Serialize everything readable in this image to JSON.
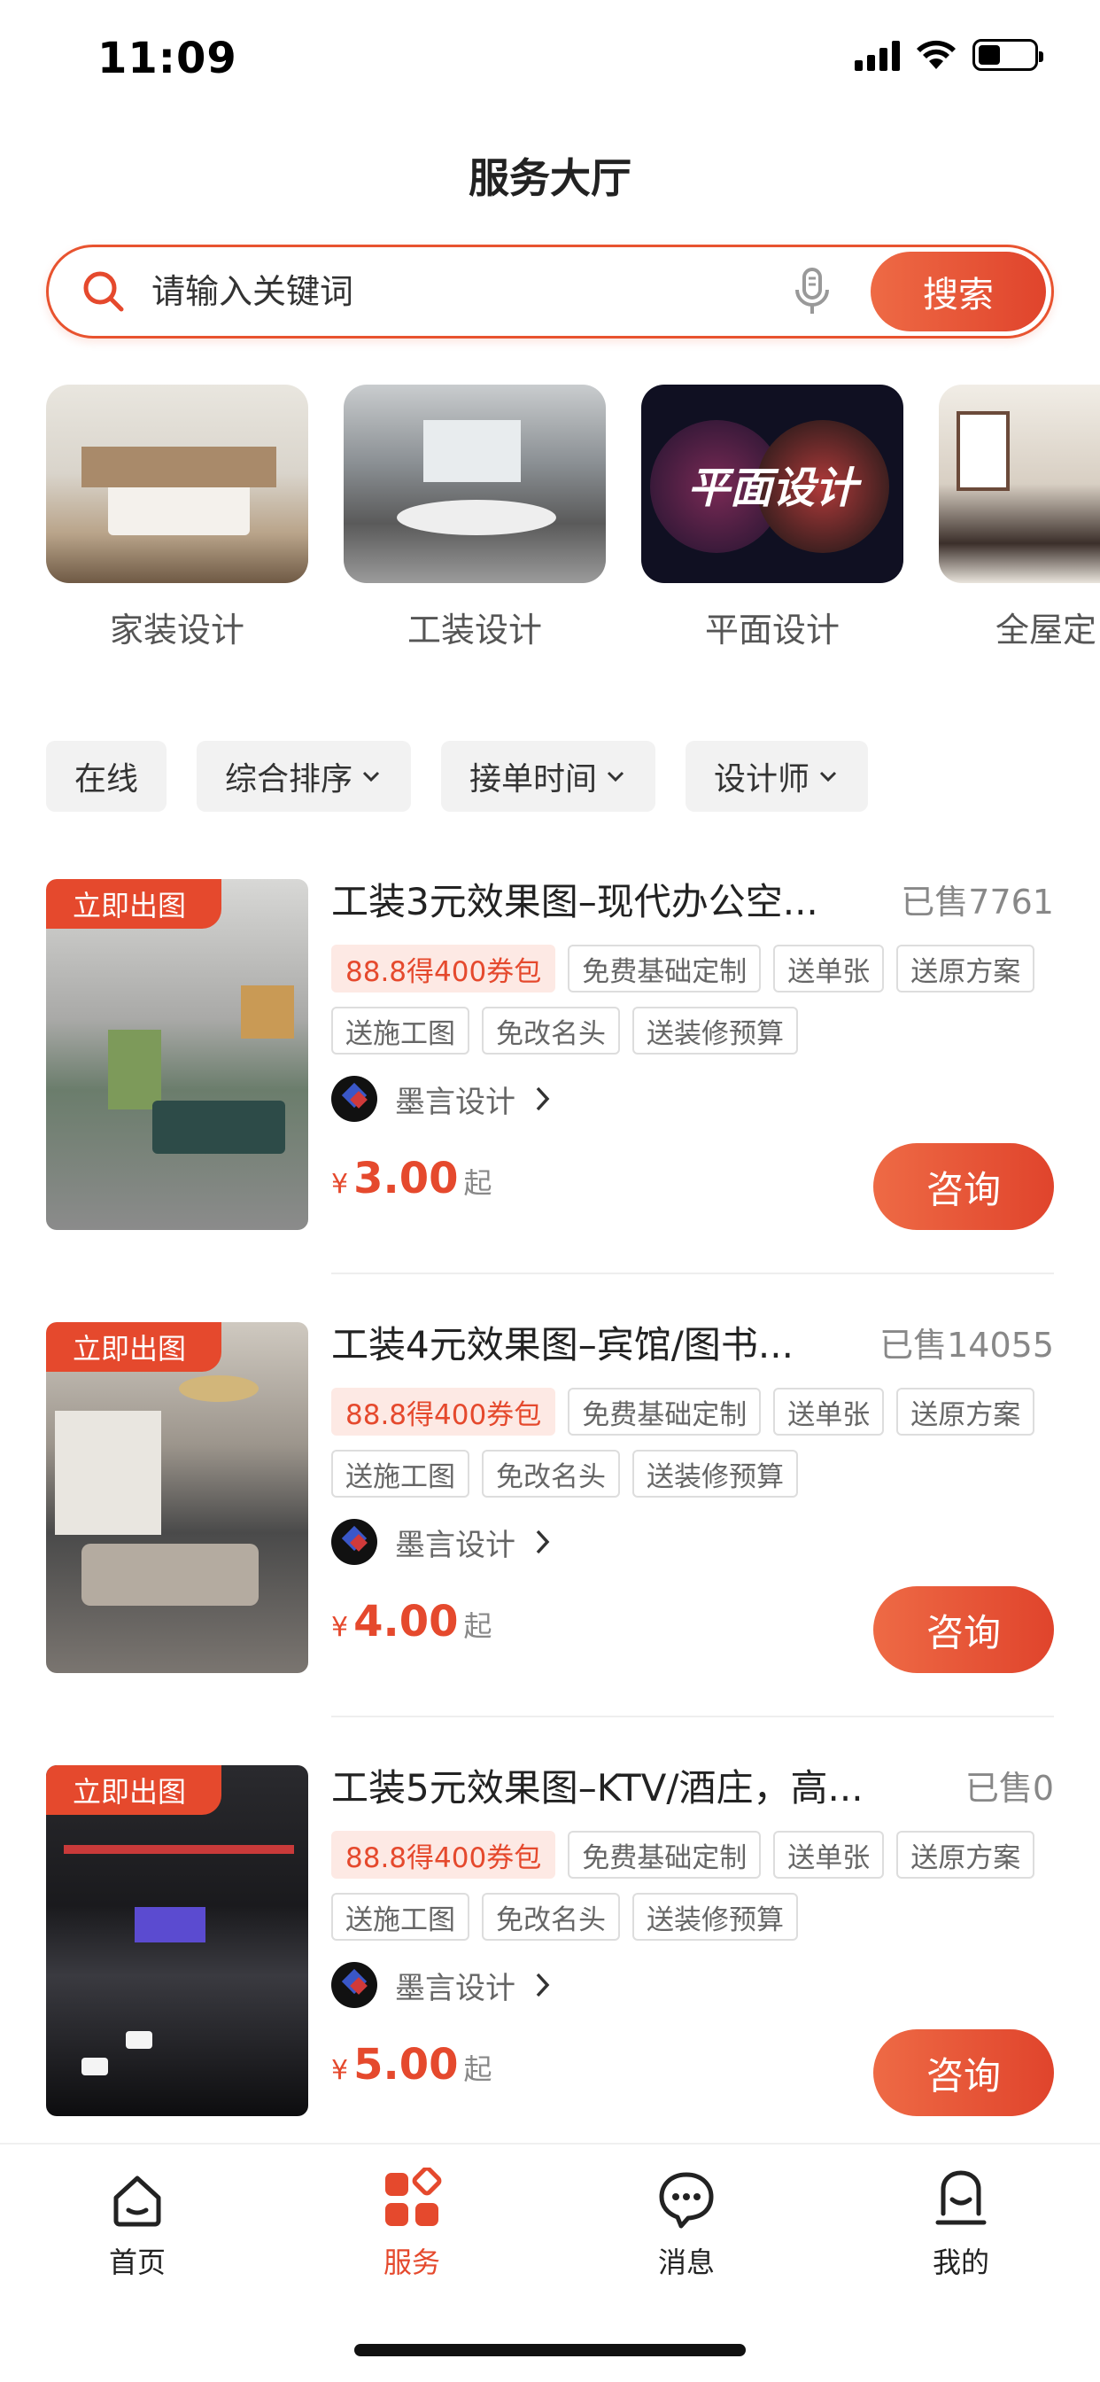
{
  "status_bar": {
    "time": "11:09"
  },
  "header": {
    "title": "服务大厅"
  },
  "search": {
    "placeholder": "请输入关键词",
    "button_label": "搜索"
  },
  "categories": [
    {
      "label": "家装设计"
    },
    {
      "label": "工装设计"
    },
    {
      "label": "平面设计",
      "image_text": "平面设计"
    },
    {
      "label": "全屋定"
    }
  ],
  "filters": [
    {
      "label": "在线"
    },
    {
      "label": "综合排序"
    },
    {
      "label": "接单时间"
    },
    {
      "label": "设计师"
    }
  ],
  "products": [
    {
      "badge": "立即出图",
      "title": "工装3元效果图–现代办公空...",
      "sold": "已售7761",
      "tags": [
        "88.8得400券包",
        "免费基础定制",
        "送单张",
        "送原方案",
        "送施工图",
        "免改名头",
        "送装修预算"
      ],
      "seller": "墨言设计",
      "currency": "¥",
      "price": "3.00",
      "price_suffix": "起",
      "action": "咨询"
    },
    {
      "badge": "立即出图",
      "title": "工装4元效果图–宾馆/图书...",
      "sold": "已售14055",
      "tags": [
        "88.8得400券包",
        "免费基础定制",
        "送单张",
        "送原方案",
        "送施工图",
        "免改名头",
        "送装修预算"
      ],
      "seller": "墨言设计",
      "currency": "¥",
      "price": "4.00",
      "price_suffix": "起",
      "action": "咨询"
    },
    {
      "badge": "立即出图",
      "title": "工装5元效果图–KTV/酒庄，高...",
      "sold": "已售0",
      "tags": [
        "88.8得400券包",
        "免费基础定制",
        "送单张",
        "送原方案",
        "送施工图",
        "免改名头",
        "送装修预算"
      ],
      "seller": "墨言设计",
      "currency": "¥",
      "price": "5.00",
      "price_suffix": "起",
      "action": "咨询"
    }
  ],
  "tabbar": [
    {
      "label": "首页",
      "icon": "home-icon"
    },
    {
      "label": "服务",
      "icon": "services-icon",
      "active": true
    },
    {
      "label": "消息",
      "icon": "message-icon"
    },
    {
      "label": "我的",
      "icon": "profile-icon"
    }
  ],
  "colors": {
    "accent": "#e5492d",
    "promo_bg": "#fde9e4"
  }
}
